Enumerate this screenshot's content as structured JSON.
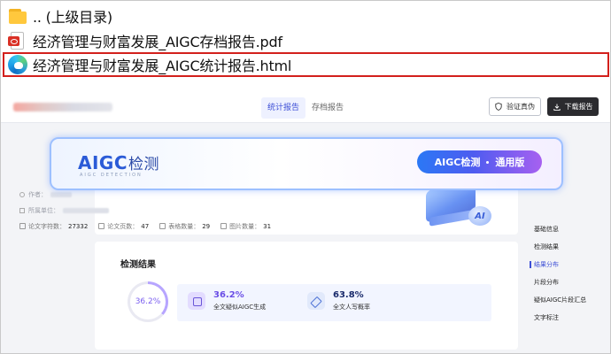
{
  "files": [
    {
      "name": "..  (上级目录)",
      "icon": "folder-icon"
    },
    {
      "name": "经济管理与财富发展_AIGC存档报告.pdf",
      "icon": "pdf-file-icon"
    },
    {
      "name": "经济管理与财富发展_AIGC统计报告.html",
      "icon": "edge-browser-icon",
      "selected": true
    }
  ],
  "report": {
    "tabs": [
      "统计报告",
      "存档报告"
    ],
    "active_tab": "统计报告",
    "verify_label": "验证真伪",
    "download_label": "下载报告",
    "banner": {
      "logo_text": "AIGC",
      "logo_cn": "检测",
      "logo_sub": "AIGC DETECTION",
      "pill_left": "AIGC检测",
      "pill_right": "通用版"
    },
    "meta": {
      "author_label": "作者：",
      "unit_label": "所属单位："
    },
    "stats": [
      {
        "label": "论文字符数：",
        "value": "27332"
      },
      {
        "label": "论文页数：",
        "value": "47"
      },
      {
        "label": "表格数量：",
        "value": "29"
      },
      {
        "label": "图片数量：",
        "value": "31"
      }
    ],
    "results": {
      "title": "检测结果",
      "ring_value": "36.2%",
      "ring_fraction": 0.362,
      "ai_value": "36.2%",
      "ai_label": "全文疑似AIGC生成",
      "human_value": "63.8%",
      "human_label": "全文人写概率"
    },
    "nav": [
      "基础信息",
      "检测结果",
      "结果分布",
      "片段分布",
      "疑似AIGC片段汇总",
      "文字标注"
    ],
    "active_nav": "结果分布"
  },
  "colors": {
    "selection_border": "#d3201c",
    "accent": "#3d4fd6",
    "ai_purple": "#6a4ee6"
  }
}
